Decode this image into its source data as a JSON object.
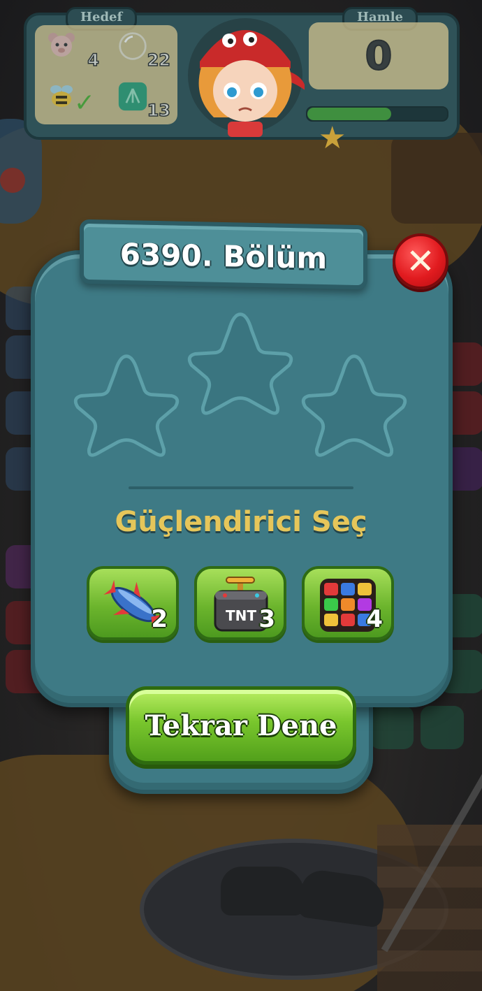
{
  "hud": {
    "goal_label": "Hedef",
    "moves_label": "Hamle",
    "moves_value": "0",
    "goals": [
      {
        "icon": "teddy-bear-icon",
        "count": "4"
      },
      {
        "icon": "bubble-icon",
        "count": "22"
      },
      {
        "icon": "bee-icon",
        "count": "",
        "completed": true
      },
      {
        "icon": "green-shell-block-icon",
        "count": "13"
      }
    ],
    "progress": 0.6
  },
  "dialog": {
    "title": "6390. Bölüm",
    "stars_earned": 0,
    "stars_total": 3,
    "booster_heading": "Güçlendirici Seç",
    "boosters": [
      {
        "name": "rocket-booster",
        "icon": "rocket-icon",
        "count": "2"
      },
      {
        "name": "tnt-booster",
        "icon": "tnt-icon",
        "count": "3"
      },
      {
        "name": "color-cube-booster",
        "icon": "color-cube-icon",
        "count": "4"
      }
    ],
    "retry_label": "Tekrar Dene",
    "close_icon": "close-icon"
  },
  "colors": {
    "dialog": "#3e7a85",
    "dialog_border": "#2c5c65",
    "heading": "#e6c65a",
    "button_green": "#79c62d",
    "close_red": "#e11b1f"
  }
}
